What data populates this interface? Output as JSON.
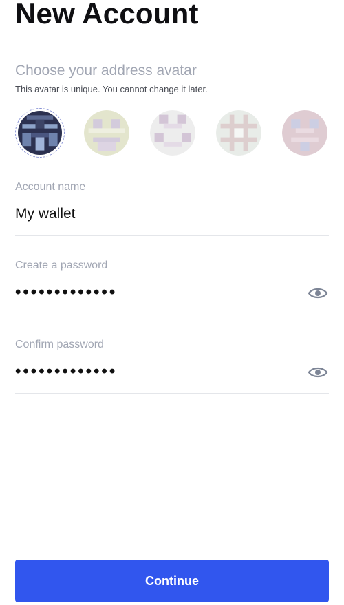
{
  "header": {
    "title": "New Account"
  },
  "avatar_section": {
    "heading": "Choose your address avatar",
    "note": "This avatar is unique. You cannot change it later.",
    "avatars": [
      {
        "icon": "pixel-avatar",
        "selected": true,
        "bg": "#2a2f4a",
        "fg": "#8aa0c8"
      },
      {
        "icon": "pixel-avatar",
        "selected": false,
        "bg": "#c9cc9e",
        "fg": "#a58aa8"
      },
      {
        "icon": "pixel-avatar",
        "selected": false,
        "bg": "#d9d9d9",
        "fg": "#9a7aa0"
      },
      {
        "icon": "pixel-avatar",
        "selected": false,
        "bg": "#c8d0c8",
        "fg": "#b58f8f"
      },
      {
        "icon": "pixel-avatar",
        "selected": false,
        "bg": "#b98a9a",
        "fg": "#8a8fc0"
      }
    ]
  },
  "account_name": {
    "label": "Account name",
    "value": "My wallet"
  },
  "password": {
    "label": "Create a password",
    "masked": "•••••••••••••",
    "icon": "eye-icon"
  },
  "confirm_password": {
    "label": "Confirm password",
    "masked": "•••••••••••••",
    "icon": "eye-icon"
  },
  "actions": {
    "continue_label": "Continue"
  },
  "colors": {
    "accent": "#3156ee",
    "label_gray": "#a1a6b3",
    "divider": "#e4e6ea"
  }
}
